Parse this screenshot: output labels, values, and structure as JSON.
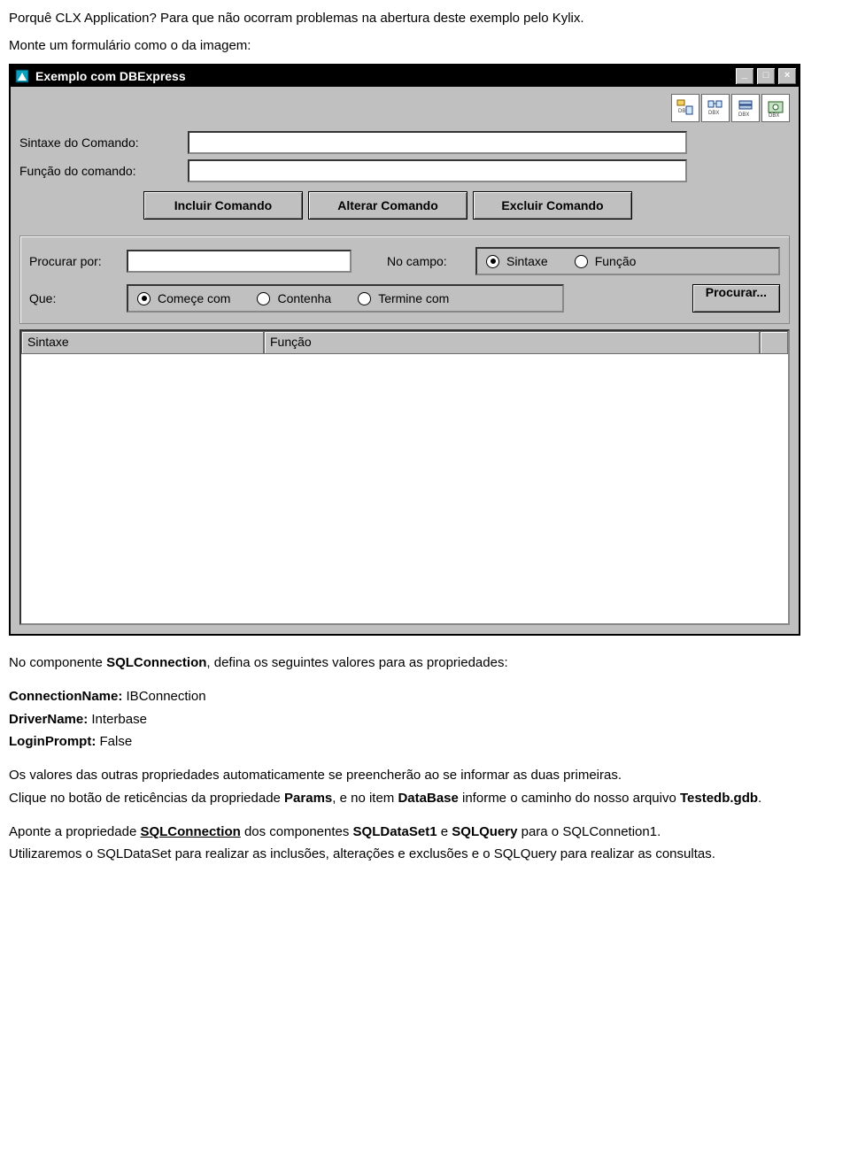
{
  "intro": {
    "line1": "Porquê CLX Application? Para que não ocorram problemas na abertura deste exemplo pelo Kylix.",
    "line2": "Monte um formulário como o da imagem:"
  },
  "window": {
    "title": "Exemplo com DBExpress",
    "tray_icons": [
      "dbx-connection-icon",
      "dbx-dataset-icon",
      "dbx-query-icon",
      "dbx-provider-icon"
    ],
    "labels": {
      "sintaxe": "Sintaxe do Comando:",
      "funcao": "Função do comando:",
      "procurar_por": "Procurar por:",
      "no_campo": "No campo:",
      "que": "Que:"
    },
    "buttons": {
      "incluir": "Incluir Comando",
      "alterar": "Alterar Comando",
      "excluir": "Excluir Comando",
      "procurar": "Procurar..."
    },
    "radios": {
      "campo": {
        "sintaxe": "Sintaxe",
        "funcao": "Função"
      },
      "que": {
        "comece": "Começe com",
        "contenha": "Contenha",
        "termine": "Termine com"
      }
    },
    "grid": {
      "col1": "Sintaxe",
      "col2": "Função"
    }
  },
  "after": {
    "p1_prefix": "No componente ",
    "p1_bold": "SQLConnection",
    "p1_suffix": ", defina os seguintes valores para as propriedades:",
    "props": {
      "cn_label": "ConnectionName:",
      "cn_value": "IBConnection",
      "dn_label": "DriverName:",
      "dn_value": "Interbase",
      "lp_label": "LoginPrompt:",
      "lp_value": "False"
    },
    "p2": "Os valores das outras propriedades automaticamente se preencherão ao se informar as duas primeiras.",
    "p3_a": "Clique no botão de reticências da propriedade ",
    "p3_b": "Params",
    "p3_c": ", e no item ",
    "p3_d": "DataBase",
    "p3_e": " informe o caminho do nosso arquivo ",
    "p3_f": "Testedb.gdb",
    "p3_g": ".",
    "p4_a": "Aponte a propriedade ",
    "p4_b": "SQLConnection",
    "p4_c": " dos componentes ",
    "p4_d": "SQLDataSet1",
    "p4_e": " e ",
    "p4_f": "SQLQuery",
    "p4_g": " para o SQLConnetion1.",
    "p5": "Utilizaremos o SQLDataSet para realizar as inclusões, alterações e exclusões e o SQLQuery para realizar as consultas."
  }
}
